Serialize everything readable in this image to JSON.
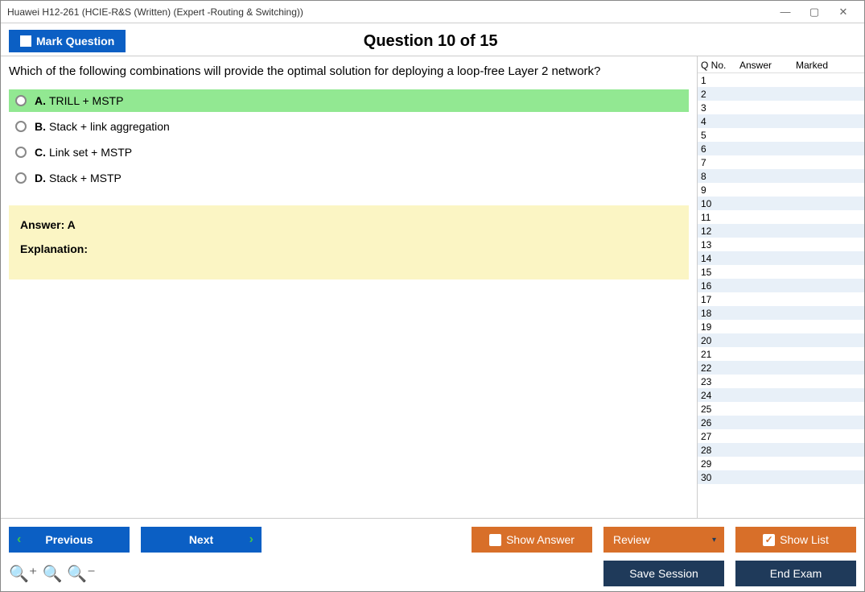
{
  "window": {
    "title": "Huawei H12-261 (HCIE-R&S (Written) (Expert -Routing & Switching))"
  },
  "header": {
    "mark_label": "Mark Question",
    "question_title": "Question 10 of 15"
  },
  "question": {
    "text": "Which of the following combinations will provide the optimal solution for deploying a loop-free Layer 2 network?",
    "options": [
      {
        "letter": "A.",
        "text": "TRILL + MSTP",
        "selected": true
      },
      {
        "letter": "B.",
        "text": "Stack + link aggregation",
        "selected": false
      },
      {
        "letter": "C.",
        "text": "Link set + MSTP",
        "selected": false
      },
      {
        "letter": "D.",
        "text": "Stack + MSTP",
        "selected": false
      }
    ]
  },
  "answer": {
    "line1": "Answer: A",
    "line2": "Explanation:"
  },
  "qlist": {
    "headers": {
      "qno": "Q No.",
      "answer": "Answer",
      "marked": "Marked"
    },
    "count": 30
  },
  "footer": {
    "previous": "Previous",
    "next": "Next",
    "show_answer": "Show Answer",
    "review": "Review",
    "show_list": "Show List",
    "save_session": "Save Session",
    "end_exam": "End Exam"
  }
}
